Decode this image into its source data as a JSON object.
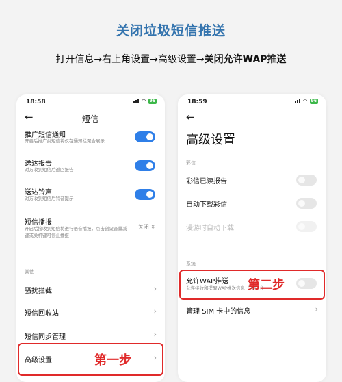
{
  "header": {
    "title": "关闭垃圾短信推送",
    "instruction_plain": "打开信息→右上角设置→高级设置→",
    "instruction_bold": "关闭允许WAP推送"
  },
  "left_phone": {
    "status_time": "18:58",
    "battery": "96",
    "title": "短信",
    "rows": [
      {
        "label": "推广短信通知",
        "sub": "开启后推广类短信将仅在通知栏聚合展示",
        "toggle": "on"
      },
      {
        "label": "送达报告",
        "sub": "对方收到短信后返回报告",
        "toggle": "on"
      },
      {
        "label": "送达铃声",
        "sub": "对方收到短信后铃音提示",
        "toggle": "on"
      },
      {
        "label": "短信播报",
        "sub": "开启后接收到短信将进行语音播报，点击创设音量减键或关机键可停止播报",
        "value": "关闭 ⇳"
      }
    ],
    "section_other": "其他",
    "items": [
      "骚扰拦截",
      "短信回收站",
      "短信同步管理",
      "高级设置"
    ],
    "step_label": "第一步"
  },
  "right_phone": {
    "status_time": "18:59",
    "battery": "96",
    "title": "高级设置",
    "section_mms": "彩信",
    "mms_rows": [
      "彩信已读报告",
      "自动下载彩信",
      "漫游时自动下载"
    ],
    "section_system": "系统",
    "wap_label": "允许WAP推送",
    "wap_sub": "允许接收和提醒WAP推送信息（PUSH）",
    "sim_label": "管理 SIM 卡中的信息",
    "step_label": "第二步"
  },
  "colors": {
    "title": "#3474ae",
    "toggle_on": "#2f7fe8",
    "highlight": "#e02a2a"
  }
}
